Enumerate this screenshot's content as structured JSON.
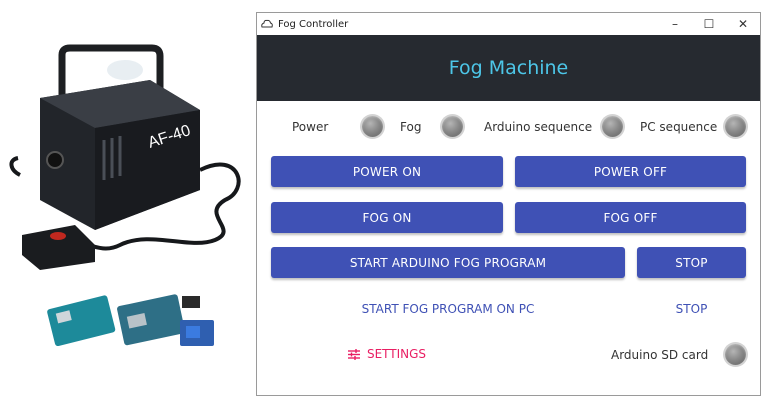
{
  "window": {
    "title": "Fog Controller",
    "controls": {
      "minimize": "–",
      "maximize": "☐",
      "close": "✕"
    }
  },
  "header": {
    "title": "Fog Machine"
  },
  "status": {
    "power": "Power",
    "fog": "Fog",
    "arduino_sequence": "Arduino sequence",
    "pc_sequence": "PC sequence",
    "sd_card": "Arduino SD card"
  },
  "buttons": {
    "power_on": "POWER ON",
    "power_off": "POWER OFF",
    "fog_on": "FOG ON",
    "fog_off": "FOG OFF",
    "start_arduino": "START ARDUINO FOG PROGRAM",
    "stop_arduino": "STOP",
    "start_pc": "START FOG PROGRAM ON PC",
    "stop_pc": "STOP",
    "settings": "SETTINGS"
  },
  "product_label": "AF-40",
  "colors": {
    "header_bg": "#262a30",
    "header_text": "#4dc6e8",
    "primary": "#3f51b5",
    "accent": "#e91e63",
    "indicator_off": "#8a8a8a"
  }
}
